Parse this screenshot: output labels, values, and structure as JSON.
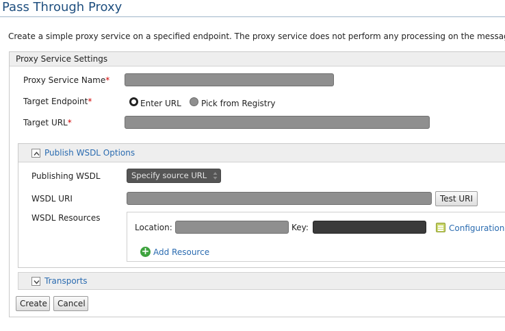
{
  "page": {
    "title": "Pass Through Proxy",
    "description": "Create a simple proxy service on a specified endpoint. The proxy service does not perform any processing on the messages"
  },
  "settings": {
    "header": "Proxy Service Settings",
    "proxy_name_label": "Proxy Service Name",
    "target_endpoint_label": "Target Endpoint",
    "target_url_label": "Target URL",
    "required_marker": "*",
    "radio_enter_url": "Enter URL",
    "radio_pick_registry": "Pick from Registry",
    "selected_radio": "Enter URL"
  },
  "wsdl": {
    "header": "Publish WSDL Options",
    "publishing_label": "Publishing WSDL",
    "publishing_value": "Specify source URL",
    "uri_label": "WSDL URI",
    "test_uri_button": "Test URI",
    "resources_label": "WSDL Resources",
    "location_label": "Location:",
    "key_label": "Key:",
    "configuration_link": "Configuration",
    "add_resource_link": "Add Resource"
  },
  "transports": {
    "header": "Transports"
  },
  "actions": {
    "create": "Create",
    "cancel": "Cancel"
  }
}
